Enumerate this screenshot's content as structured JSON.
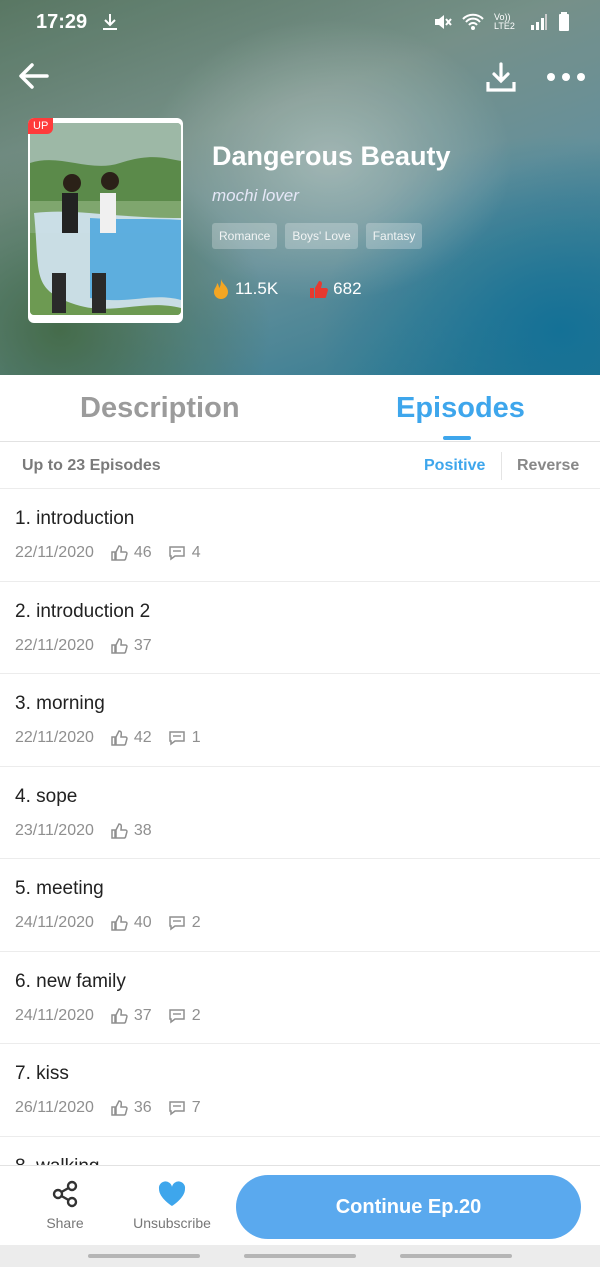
{
  "status_bar": {
    "time": "17:29",
    "network_label": "Vo)) LTE2"
  },
  "header": {
    "back_icon": "back-arrow-icon",
    "download_icon": "download-icon",
    "more_icon": "more-icon"
  },
  "comic": {
    "badge": "UP",
    "title": "Dangerous Beauty",
    "author": "mochi lover",
    "tags": [
      "Romance",
      "Boys' Love",
      "Fantasy"
    ],
    "views": "11.5K",
    "likes": "682"
  },
  "tabs": {
    "description": "Description",
    "episodes": "Episodes",
    "active": "Episodes"
  },
  "sort": {
    "count_label": "Up to 23 Episodes",
    "positive": "Positive",
    "reverse": "Reverse",
    "selected": "Positive"
  },
  "episodes": [
    {
      "title": "1. introduction",
      "date": "22/11/2020",
      "likes": "46",
      "comments": "4"
    },
    {
      "title": "2. introduction 2",
      "date": "22/11/2020",
      "likes": "37",
      "comments": ""
    },
    {
      "title": "3. morning",
      "date": "22/11/2020",
      "likes": "42",
      "comments": "1"
    },
    {
      "title": "4. sope",
      "date": "23/11/2020",
      "likes": "38",
      "comments": ""
    },
    {
      "title": "5. meeting",
      "date": "24/11/2020",
      "likes": "40",
      "comments": "2"
    },
    {
      "title": "6. new family",
      "date": "24/11/2020",
      "likes": "37",
      "comments": "2"
    },
    {
      "title": "7. kiss",
      "date": "26/11/2020",
      "likes": "36",
      "comments": "7"
    },
    {
      "title": "8. walking",
      "date": "",
      "likes": "",
      "comments": ""
    }
  ],
  "bottom_bar": {
    "share": "Share",
    "unsubscribe": "Unsubscribe",
    "continue": "Continue Ep.20"
  },
  "colors": {
    "accent": "#3ea6ec",
    "button": "#5aa9ee",
    "badge": "#ff3b3b"
  }
}
